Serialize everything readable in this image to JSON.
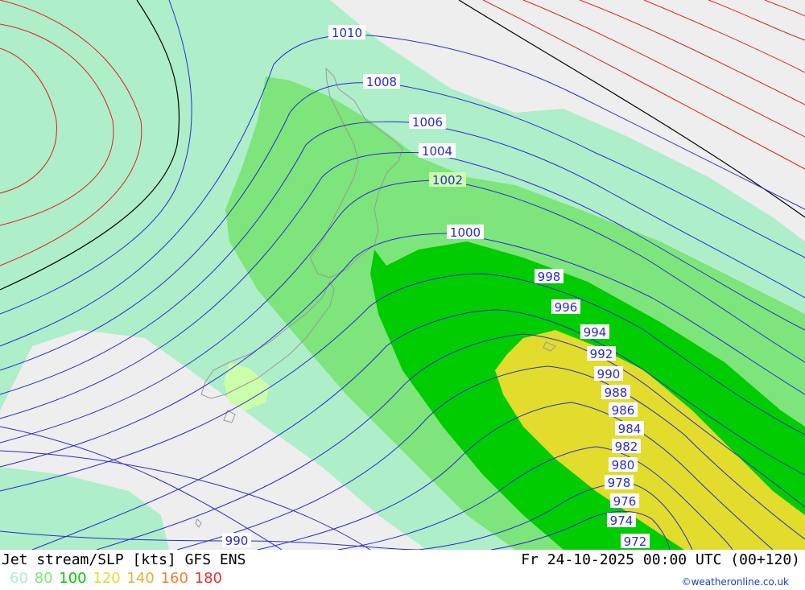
{
  "map": {
    "fill_colors": {
      "background": "#eeeeee",
      "speed_60": "#aeeec9",
      "speed_80": "#7de57b",
      "speed_100": "#00cc00",
      "speed_120": "#e2dc2c",
      "small_patch": "#ccffaa"
    },
    "isobar_color": "#2b2bd0",
    "jet_isoline_color": "#dd2222",
    "zero_line_color": "#000000",
    "isobar_labels": [
      "1010",
      "1008",
      "1006",
      "1004",
      "1002",
      "1000",
      "998",
      "996",
      "994",
      "992",
      "990",
      "988",
      "986",
      "984",
      "982",
      "980",
      "978",
      "976",
      "974",
      "972",
      "990"
    ]
  },
  "footer": {
    "title_left": "Jet stream/SLP [kts] GFS ENS",
    "title_right": "Fr 24-10-2025 00:00 UTC (00+120)",
    "legend": [
      {
        "label": "60",
        "color": "#aeeec9"
      },
      {
        "label": "80",
        "color": "#7de57b"
      },
      {
        "label": "100",
        "color": "#00cc00"
      },
      {
        "label": "120",
        "color": "#e2dc2c"
      },
      {
        "label": "140",
        "color": "#e8b030"
      },
      {
        "label": "160",
        "color": "#f08030"
      },
      {
        "label": "180",
        "color": "#e83030"
      }
    ],
    "credit": "©weatheronline.co.uk"
  }
}
